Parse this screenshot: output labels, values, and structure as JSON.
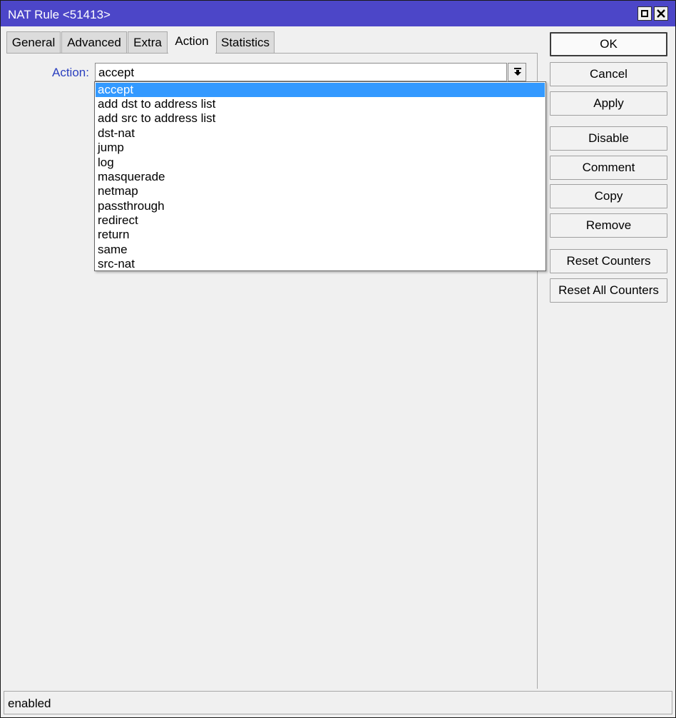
{
  "window": {
    "title": "NAT Rule <51413>"
  },
  "tabs": [
    "General",
    "Advanced",
    "Extra",
    "Action",
    "Statistics"
  ],
  "active_tab": "Action",
  "action": {
    "label": "Action:",
    "value": "accept",
    "options": [
      "accept",
      "add dst to address list",
      "add src to address list",
      "dst-nat",
      "jump",
      "log",
      "masquerade",
      "netmap",
      "passthrough",
      "redirect",
      "return",
      "same",
      "src-nat"
    ],
    "highlighted": "accept"
  },
  "buttons": {
    "ok": "OK",
    "cancel": "Cancel",
    "apply": "Apply",
    "disable": "Disable",
    "comment": "Comment",
    "copy": "Copy",
    "remove": "Remove",
    "reset_counters": "Reset Counters",
    "reset_all_counters": "Reset All Counters"
  },
  "status": "enabled",
  "colors": {
    "titlebar": "#4c46c8",
    "highlight": "#3399ff",
    "label": "#2a3fbf"
  },
  "icons": {
    "maximize": "maximize-icon",
    "close": "close-icon",
    "dropdown": "dropdown-arrow-icon"
  }
}
